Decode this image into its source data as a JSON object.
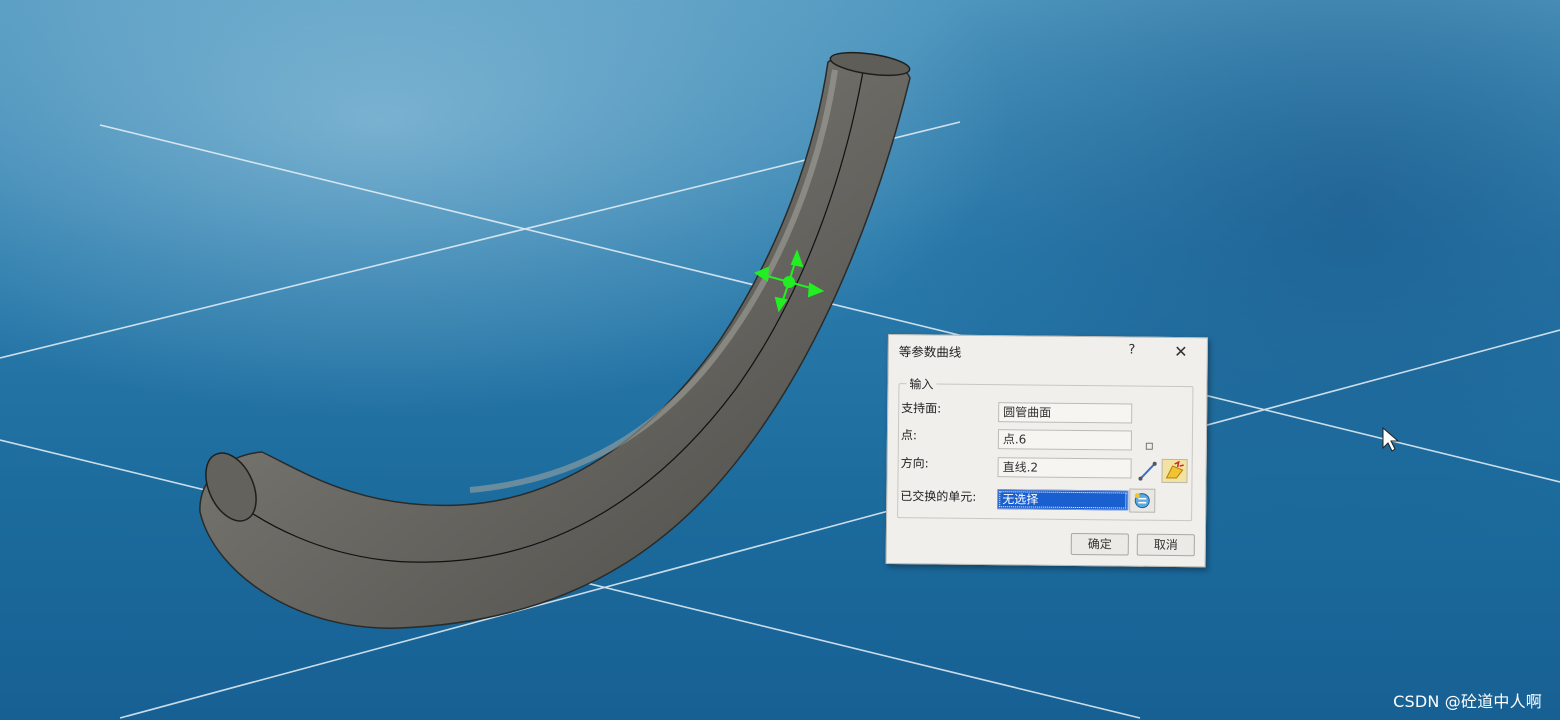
{
  "dialog": {
    "title": "等参数曲线",
    "help_label": "?",
    "close_label": "✕",
    "group_label": "输入",
    "rows": [
      {
        "label": "支持面:",
        "value": "圆管曲面"
      },
      {
        "label": "点:",
        "value": "点.6"
      },
      {
        "label": "方向:",
        "value": "直线.2"
      },
      {
        "label": "已交换的单元:",
        "value": "无选择"
      }
    ],
    "ok_label": "确定",
    "cancel_label": "取消"
  },
  "icons": {
    "direction_line": "line-direction-icon",
    "direction_picker": "compass-direction-icon",
    "swap_selection": "swap-element-icon",
    "manipulator": "point-manipulator-icon",
    "cursor": "mouse-cursor-icon"
  },
  "colors": {
    "background": "#1f6b99",
    "tube": "#6e6d68",
    "manipulator": "#22ee22",
    "selection": "#1a5fd0"
  },
  "watermark": "CSDN @砼道中人啊"
}
